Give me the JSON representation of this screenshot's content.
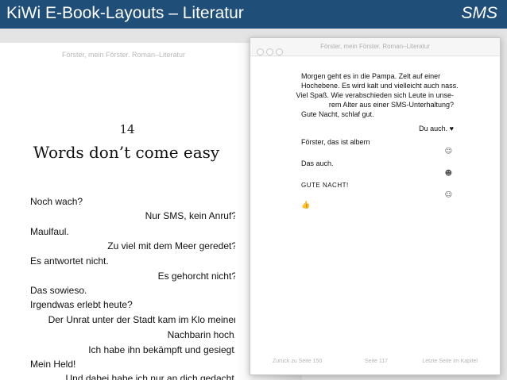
{
  "header": {
    "title": "KiWi E-Book-Layouts – Literatur",
    "tag": "SMS",
    "background": "#1f4e79"
  },
  "left_page": {
    "running_head": "Förster, mein Förster. Roman–Literatur",
    "chapter_number": "14",
    "chapter_title": "Words don’t come easy",
    "lines": [
      "Noch wach?",
      "Nur SMS, kein Anruf?",
      "Maulfaul.",
      "Zu viel mit dem Meer geredet?",
      "Es antwortet nicht.",
      "Es gehorcht nicht?",
      "Das sowieso.",
      "Irgendwas erlebt heute?",
      "Der Unrat unter der Stadt kam im Klo meiner",
      "Nachbarin hoch.",
      "Ich habe ihn bekämpft und gesiegt.",
      "Mein Held!",
      "Und dabei habe ich nur an dich gedacht."
    ]
  },
  "window": {
    "title": "Förster, mein Förster. Roman–Literatur",
    "messages": [
      "Morgen geht es in die Pampa. Zelt auf einer",
      "Hochebene. Es wird kalt und vielleicht auch nass.",
      "Viel Spaß. Wie verabschieden sich Leute in unse-",
      "rem Alter aus einer SMS-Unterhaltung?",
      "Gute Nacht, schlaf gut.",
      "Du auch. ♥",
      "Förster, das ist albern",
      "☺",
      "Das auch.",
      "☻",
      "GUTE NACHT!",
      "☺",
      "👍"
    ],
    "footer": {
      "prev": "Zurück zu Seite 150",
      "page": "Seite 117",
      "next": "Letzte Seite im Kapitel"
    }
  }
}
